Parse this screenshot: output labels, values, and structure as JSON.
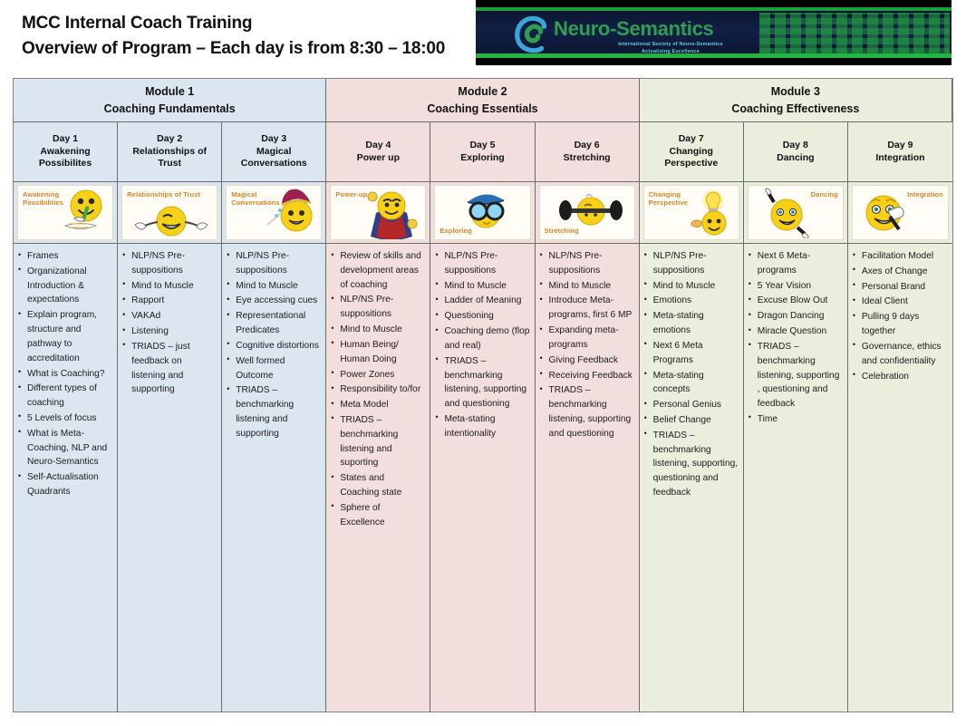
{
  "header": {
    "title_line1": "MCC Internal Coach Training",
    "title_line2": "Overview of Program – Each day is from 8:30 – 18:00",
    "logo": {
      "word1": "Neuro",
      "dash": "-",
      "word2": "Semantics",
      "tagline_line1": "International Society of Neuro-Semantics",
      "tagline_line2": "Actualising Excellence"
    }
  },
  "modules": [
    {
      "name": "Module 1",
      "subtitle": "Coaching Fundamentals",
      "color": "#dce6f1"
    },
    {
      "name": "Module 2",
      "subtitle": "Coaching Essentials",
      "color": "#f2dedd"
    },
    {
      "name": "Module 3",
      "subtitle": "Coaching Effectiveness",
      "color": "#eaeedc"
    }
  ],
  "days": [
    {
      "day": "Day 1",
      "name_line1": "Awakening",
      "name_line2": "Possibilites",
      "tile_label_line1": "Awakening",
      "tile_label_line2": "Possibilities",
      "tile_icon": "smiley-writing-icon",
      "items": [
        "Frames",
        "Organizational Introduction & expectations",
        "Explain program, structure and pathway to accreditation",
        "What is Coaching?",
        "Different types of coaching",
        "5 Levels of focus",
        "What is Meta-Coaching, NLP and Neuro-Semantics",
        "Self-Actualisation Quadrants"
      ]
    },
    {
      "day": "Day 2",
      "name_line1": "Relationships of",
      "name_line2": "Trust",
      "tile_label_line1": "Relationships of Trust",
      "tile_label_line2": "",
      "tile_icon": "smiley-open-arms-icon",
      "items": [
        "NLP/NS Pre-suppositions",
        "Mind to Muscle",
        "Rapport",
        "VAKAd",
        "Listening",
        "TRIADS – just feedback on listening and supporting"
      ]
    },
    {
      "day": "Day 3",
      "name_line1": "Magical",
      "name_line2": "Conversations",
      "tile_label_line1": "Magical",
      "tile_label_line2": "Conversations",
      "tile_icon": "smiley-wizard-icon",
      "items": [
        "NLP/NS Pre-suppositions",
        "Mind to Muscle",
        "Eye accessing cues",
        "Representational Predicates",
        "Cognitive distortions",
        "Well formed Outcome",
        "TRIADS – benchmarking listening and supporting"
      ]
    },
    {
      "day": "Day 4",
      "name_line1": "Power up",
      "name_line2": "",
      "tile_label_line1": "Power-up",
      "tile_label_line2": "",
      "tile_icon": "smiley-superhero-icon",
      "items": [
        "Review of skills and development areas of coaching",
        "NLP/NS Pre-suppositions",
        "Mind to Muscle",
        "Human Being/ Human Doing",
        "Power Zones",
        "Responsibility to/for",
        "Meta Model",
        "TRIADS – benchmarking listening and suporting",
        "States and Coaching state",
        "Sphere of Excellence"
      ]
    },
    {
      "day": "Day 5",
      "name_line1": "Exploring",
      "name_line2": "",
      "tile_label_line1": "Exploring",
      "tile_label_line2": "",
      "tile_icon": "smiley-explorer-goggles-icon",
      "items": [
        "NLP/NS Pre-suppositions",
        "Mind to Muscle",
        "Ladder of Meaning",
        "Questioning",
        "Coaching demo (flop and real)",
        "TRIADS – benchmarking listening, supporting and questioning",
        "Meta-stating intentionality"
      ]
    },
    {
      "day": "Day 6",
      "name_line1": "Stretching",
      "name_line2": "",
      "tile_label_line1": "Stretching",
      "tile_label_line2": "",
      "tile_icon": "smiley-barbell-icon",
      "items": [
        "NLP/NS Pre-suppositions",
        "Mind to Muscle",
        "Introduce Meta-programs, first 6 MP",
        "Expanding meta-programs",
        "Giving Feedback",
        "Receiving Feedback",
        "TRIADS – benchmarking listening, supporting and questioning"
      ]
    },
    {
      "day": "Day 7",
      "name_line1": "Changing",
      "name_line2": "Perspective",
      "tile_label_line1": "Changing",
      "tile_label_line2": "Perspective",
      "tile_icon": "smiley-lightbulb-idea-icon",
      "items": [
        "NLP/NS Pre-suppositions",
        "Mind to Muscle",
        "Emotions",
        "Meta-stating emotions",
        "Next 6 Meta Programs",
        "Meta-stating concepts",
        "Personal Genius",
        "Belief Change",
        "TRIADS – benchmarking listening, supporting, questioning and feedback"
      ]
    },
    {
      "day": "Day 8",
      "name_line1": "Dancing",
      "name_line2": "",
      "tile_label_line1": "Dancing",
      "tile_label_line2": "",
      "tile_icon": "smiley-dancing-icon",
      "items": [
        "Next 6 Meta-programs",
        "5 Year Vision",
        "Excuse Blow Out",
        "Dragon Dancing",
        "Miracle Question",
        "TRIADS – benchmarking listening, supporting , questioning and feedback",
        "Time"
      ]
    },
    {
      "day": "Day 9",
      "name_line1": "Integration",
      "name_line2": "",
      "tile_label_line1": "Integration",
      "tile_label_line2": "",
      "tile_icon": "smiley-thumbs-up-icon",
      "items": [
        "Facilitation Model",
        "Axes of Change",
        "Personal Brand",
        "Ideal Client",
        "Pulling 9 days together",
        "Governance, ethics and confidentiality",
        "Celebration"
      ]
    }
  ]
}
